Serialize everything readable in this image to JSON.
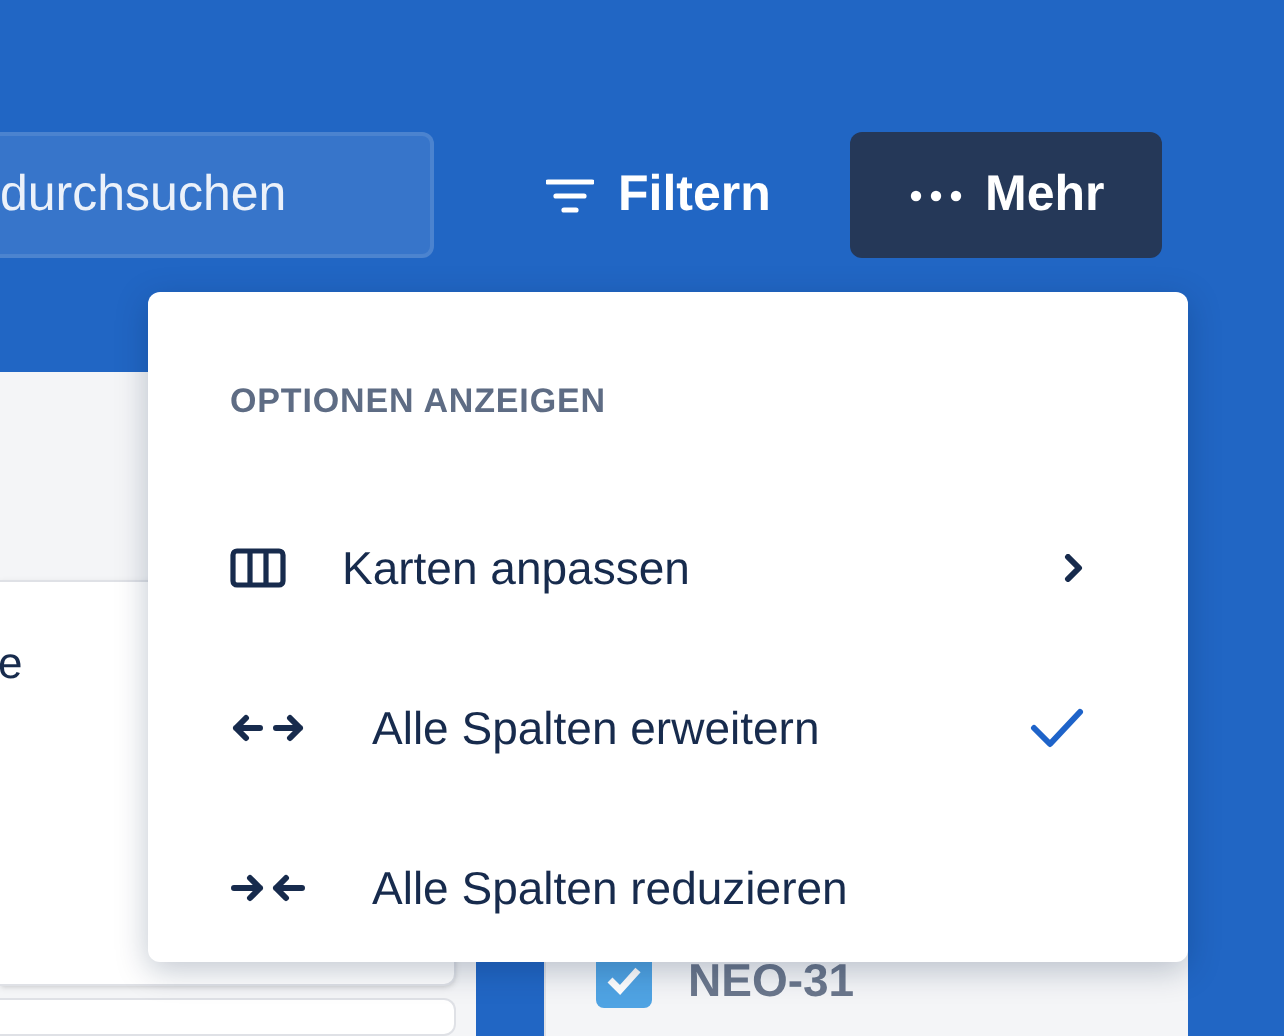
{
  "toolbar": {
    "search": {
      "value": "durchsuchen"
    },
    "filter_button": "Filtern",
    "more_button": "Mehr"
  },
  "board": {
    "left_card_text": "e",
    "right_card": {
      "key": "NEO-31",
      "done": true
    }
  },
  "menu": {
    "heading": "OPTIONEN ANZEIGEN",
    "items": [
      {
        "kind": "columns",
        "label": "Karten anpassen",
        "submenu": true,
        "checked": false
      },
      {
        "kind": "expand",
        "label": "Alle Spalten erweitern",
        "submenu": false,
        "checked": true
      },
      {
        "kind": "collapse",
        "label": "Alle Spalten reduzieren",
        "submenu": false,
        "checked": false
      }
    ]
  }
}
